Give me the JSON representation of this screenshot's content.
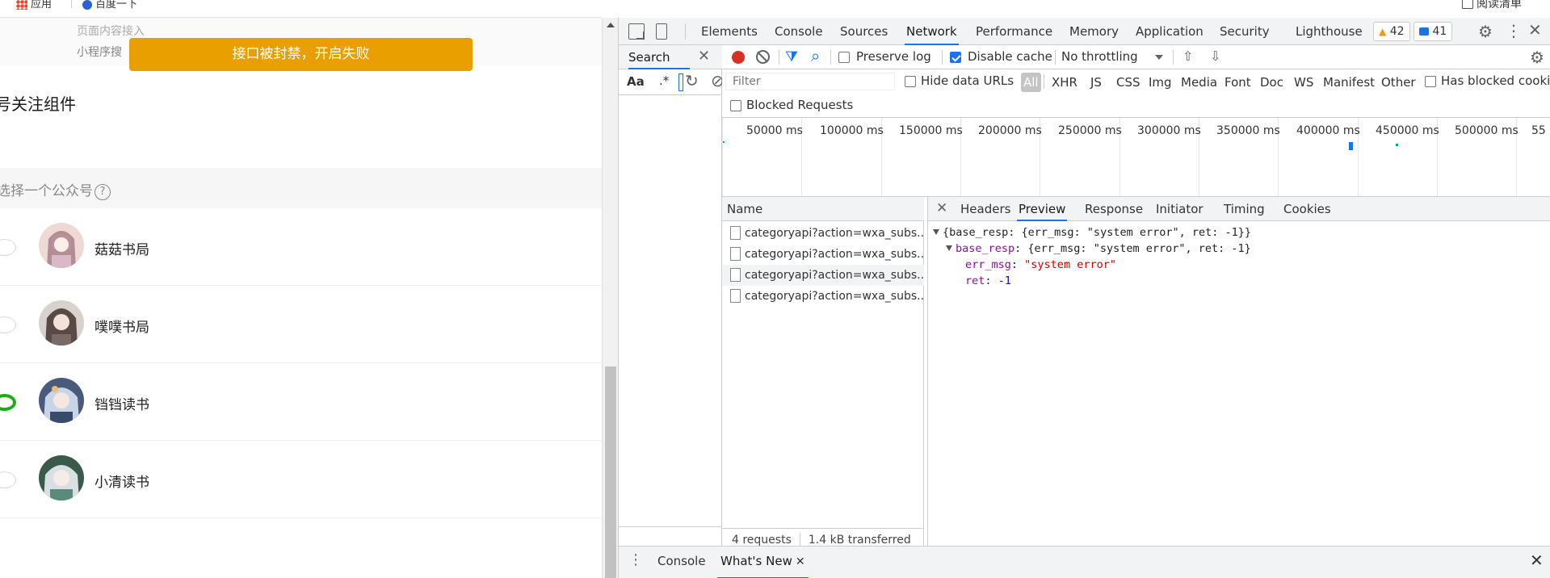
{
  "bookmarks": {
    "apps_label": "应用",
    "baidu_label": "百度一下"
  },
  "reading_list_label": "阅读清单",
  "page": {
    "sub_menu": [
      "页面内容接入",
      "小程序搜"
    ],
    "toast": "接口被封禁，开启失败",
    "section_title": "号关注组件",
    "choose_label": "选择一个公众号",
    "help_glyph": "?",
    "accounts": [
      {
        "name": "菇菇书局",
        "selected": false
      },
      {
        "name": "噗噗书局",
        "selected": false
      },
      {
        "name": "铛铛读书",
        "selected": true
      },
      {
        "name": "小清读书",
        "selected": false
      }
    ]
  },
  "devtools": {
    "tabs": [
      "Elements",
      "Console",
      "Sources",
      "Network",
      "Performance",
      "Memory",
      "Application",
      "Security",
      "Lighthouse"
    ],
    "active_tab": "Network",
    "warnings_count": "42",
    "messages_count": "41",
    "search": {
      "tab_label": "Search",
      "case_label": "Aa",
      "regex_label": ".*"
    },
    "network": {
      "preserve_log_label": "Preserve log",
      "disable_cache_label": "Disable cache",
      "throttling_label": "No throttling",
      "filter_placeholder": "Filter",
      "hide_data_urls_label": "Hide data URLs",
      "types": [
        "All",
        "XHR",
        "JS",
        "CSS",
        "Img",
        "Media",
        "Font",
        "Doc",
        "WS",
        "Manifest",
        "Other"
      ],
      "has_blocked_cookies_label": "Has blocked cookies",
      "blocked_requests_label": "Blocked Requests",
      "timeline_labels": [
        "50000 ms",
        "100000 ms",
        "150000 ms",
        "200000 ms",
        "250000 ms",
        "300000 ms",
        "350000 ms",
        "400000 ms",
        "450000 ms",
        "500000 ms",
        "55"
      ],
      "name_header": "Name",
      "requests": [
        "categoryapi?action=wxa_subs...",
        "categoryapi?action=wxa_subs...",
        "categoryapi?action=wxa_subs...",
        "categoryapi?action=wxa_subs..."
      ],
      "requests_count": "4 requests",
      "transferred": "1.4 kB transferred",
      "detail_tabs": [
        "Headers",
        "Preview",
        "Response",
        "Initiator",
        "Timing",
        "Cookies"
      ],
      "active_detail_tab": "Preview",
      "preview": {
        "line1": "{base_resp: {err_msg: \"system error\", ret: -1}}",
        "line2_key": "base_resp",
        "line2_val": ": {err_msg: \"system error\", ret: -1}",
        "err_msg_key": "err_msg",
        "err_msg_val": "\"system error\"",
        "ret_key": "ret",
        "ret_val": "-1"
      }
    },
    "drawer": {
      "console_label": "Console",
      "whats_new_label": "What's New"
    }
  },
  "colors": {
    "toast_bg": "#e99f00",
    "selected_radio": "#1aad19",
    "accent": "#1a73e8",
    "record": "#d93025"
  }
}
